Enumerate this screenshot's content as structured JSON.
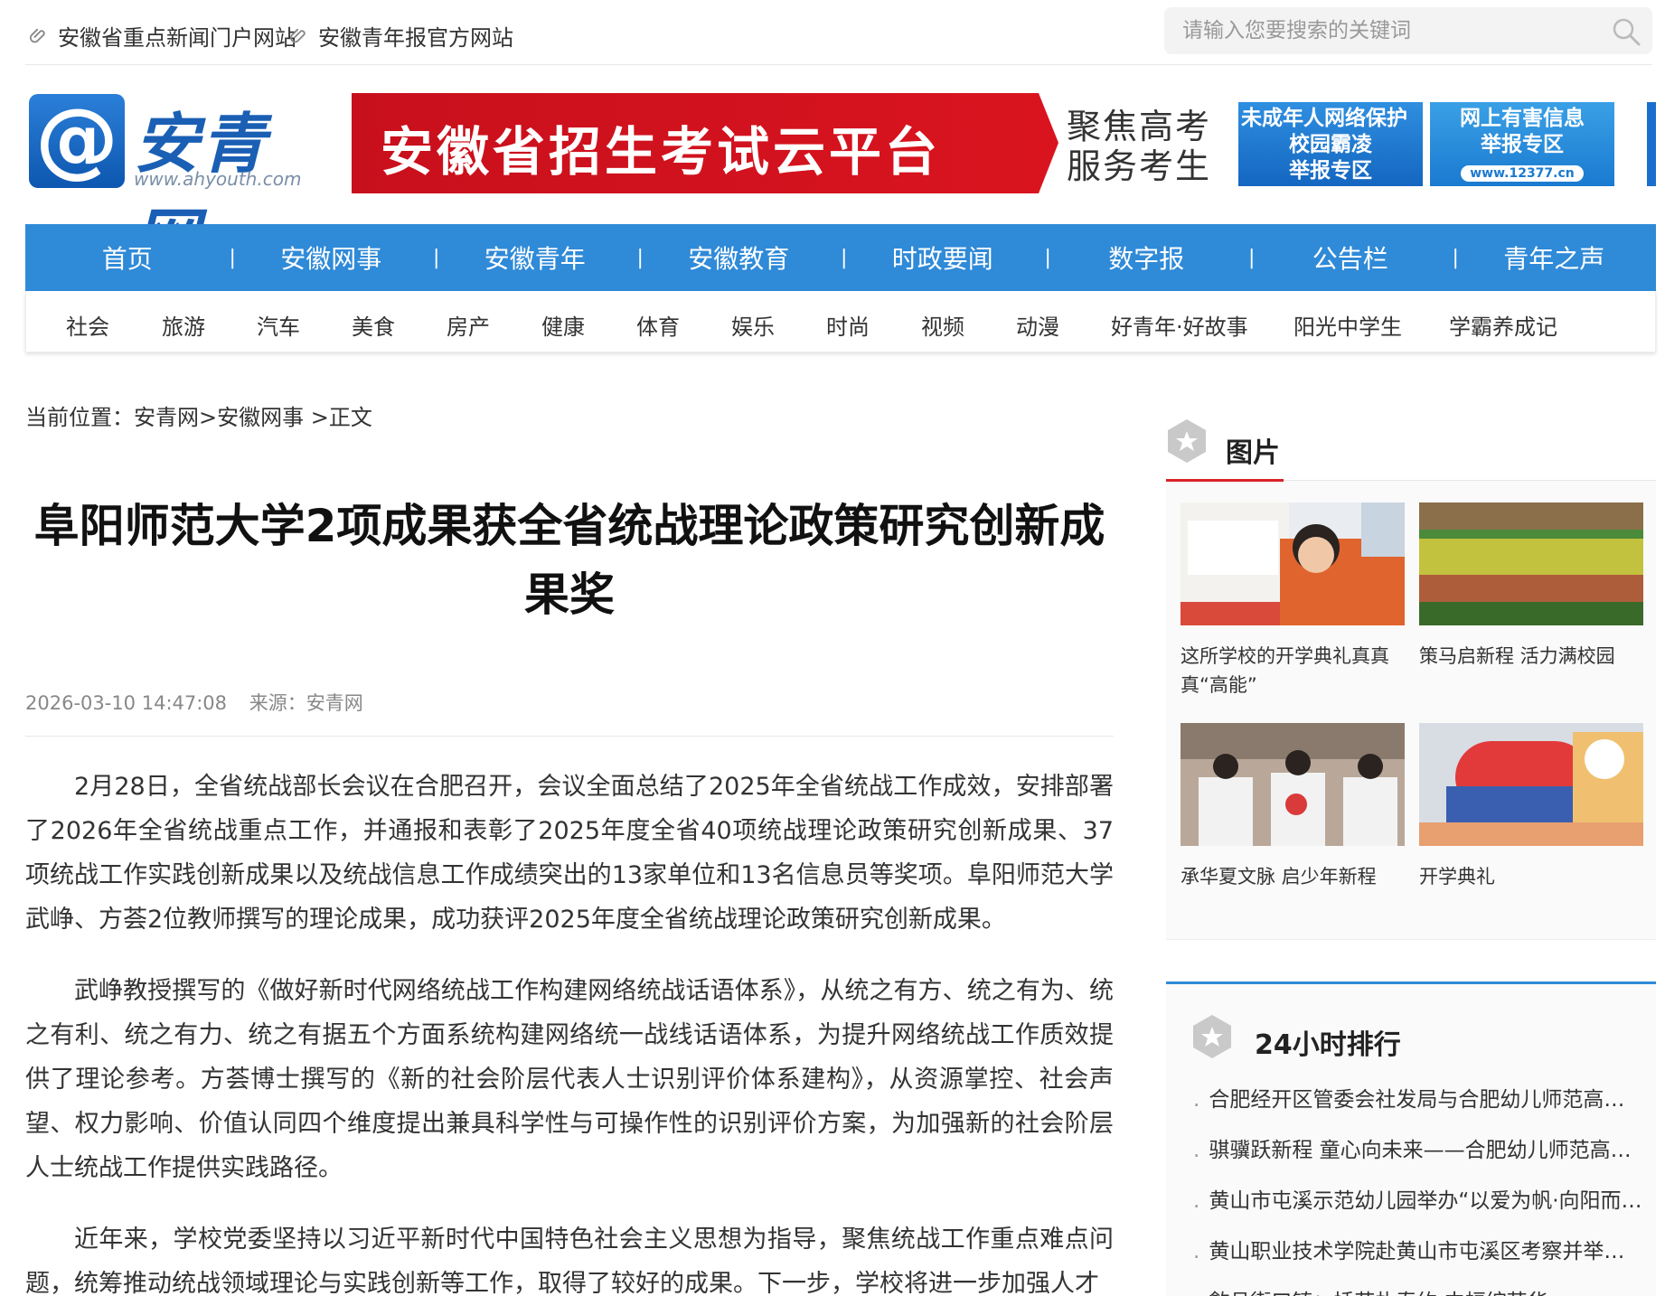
{
  "topbar": {
    "link1": "安徽省重点新闻门户网站",
    "link2": "安徽青年报官方网站",
    "search_placeholder": "请输入您要搜索的关键词"
  },
  "logo": {
    "mark": "@",
    "name": "安青网",
    "url": "www.ahyouth.com"
  },
  "banners": {
    "main": "安徽省招生考试云平台",
    "side_line1": "聚焦高考",
    "side_line2": "服务考生",
    "blue1_lines": [
      "未成年人网络保护",
      "校园霸凌",
      "举报专区"
    ],
    "blue2_lines": [
      "网上有害信息",
      "举报专区"
    ],
    "blue2_pill": "www.12377.cn"
  },
  "nav": {
    "items": [
      "首页",
      "安徽网事",
      "安徽青年",
      "安徽教育",
      "时政要闻",
      "数字报",
      "公告栏",
      "青年之声"
    ],
    "separator": "|"
  },
  "subnav": {
    "items": [
      "社会",
      "旅游",
      "汽车",
      "美食",
      "房产",
      "健康",
      "体育",
      "娱乐",
      "时尚",
      "视频",
      "动漫",
      "好青年·好故事",
      "阳光中学生",
      "学霸养成记"
    ]
  },
  "breadcrumb": "当前位置：安青网>安徽网事 >正文",
  "article": {
    "title": "阜阳师范大学2项成果获全省统战理论政策研究创新成果奖",
    "datetime": "2026-03-10 14:47:08",
    "source": "来源：安青网",
    "paragraphs": [
      "2月28日，全省统战部长会议在合肥召开，会议全面总结了2025年全省统战工作成效，安排部署了2026年全省统战重点工作，并通报和表彰了2025年度全省40项统战理论政策研究创新成果、37项统战工作实践创新成果以及统战信息工作成绩突出的13家单位和13名信息员等奖项。阜阳师范大学武峥、方荟2位教师撰写的理论成果，成功获评2025年度全省统战理论政策研究创新成果。",
      "武峥教授撰写的《做好新时代网络统战工作构建网络统战话语体系》，从统之有方、统之有为、统之有利、统之有力、统之有据五个方面系统构建网络统一战线话语体系，为提升网络统战工作质效提供了理论参考。方荟博士撰写的《新的社会阶层代表人士识别评价体系建构》，从资源掌控、社会声望、权力影响、价值认同四个维度提出兼具科学性与可操作性的识别评价方案，为加强新的社会阶层人士统战工作提供实践路径。",
      "近年来，学校党委坚持以习近平新时代中国特色社会主义思想为指导，聚焦统战工作重点难点问题，统筹推动统战领域理论与实践创新等工作，取得了较好的成果。下一步，学校将进一步加强人才"
    ]
  },
  "sidebar": {
    "pictures_title": "图片",
    "pictures": [
      {
        "caption": "这所学校的开学典礼真真真“高能”"
      },
      {
        "caption": "策马启新程 活力满校园"
      },
      {
        "caption": "承华夏文脉 启少年新程"
      },
      {
        "caption": "开学典礼"
      }
    ],
    "ranking_title": "24小时排行",
    "ranking": [
      "合肥经开区管委会社发局与合肥幼儿师范高等专科学校",
      "骐骥跃新程 童心向未来——合肥幼儿师范高等专科学校",
      "黄山市屯溪示范幼儿园举办“以爱为帆·向阳而行”",
      "黄山职业技术学院赴黄山市屯溪区考察并举行座谈",
      "歙县街口镇：插花扎春约 中幅绽芳华"
    ]
  },
  "colors": {
    "nav_blue": "#2f8ad8",
    "banner_red": "#c8101c",
    "accent_red": "#d8232a"
  }
}
